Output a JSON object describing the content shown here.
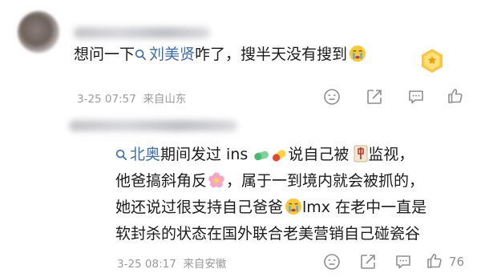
{
  "comment_1": {
    "text_before": "想问一下",
    "topic_link": "刘美贤",
    "text_after": "咋了，搜半天没有搜到",
    "time": "3-25 07:57",
    "location": "来自山东"
  },
  "comment_2": {
    "topic_link": "北奥",
    "line1_a": "期间发过 ins",
    "line1_b": "说自己被",
    "line1_c": "监视，",
    "line2_a": "他爸搞斜角反",
    "line2_b": "，属于一到境内就会被抓的，",
    "line3_a": "她还说过很支持自己爸爸",
    "line3_b": "lmx 在老中一直是",
    "line4": "软封杀的状态在国外联合老美营销自己碰瓷谷",
    "time": "3-25 08:17",
    "location": "来自安徽",
    "like_count": "76"
  },
  "icons": {
    "search": "search-icon",
    "comment": "comment-icon",
    "share": "share-icon",
    "message": "message-icon",
    "like": "thumbs-up-icon",
    "badge": "gold-badge-icon"
  },
  "colors": {
    "link": "#3f6da6",
    "meta": "#9a9a9a"
  }
}
